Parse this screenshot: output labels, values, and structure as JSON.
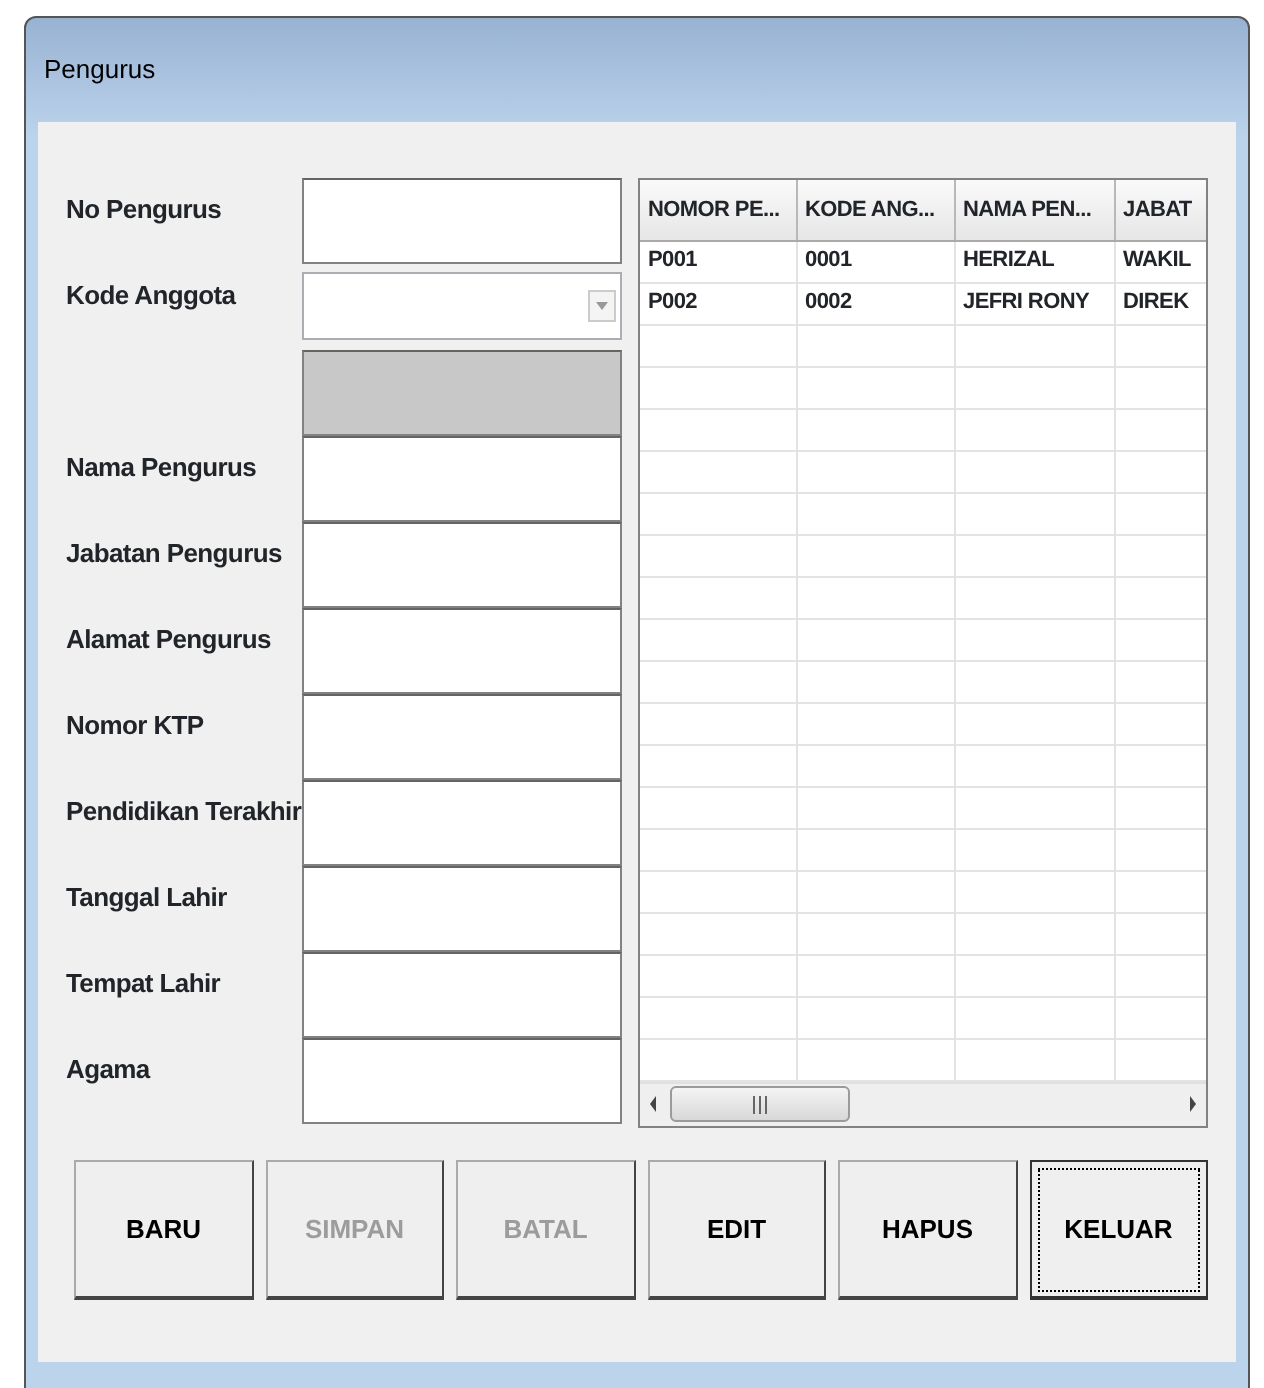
{
  "window": {
    "title": "Pengurus"
  },
  "fields": [
    {
      "label": "No Pengurus",
      "kind": "text",
      "disabled": false
    },
    {
      "label": "Kode Anggota",
      "kind": "combo",
      "disabled": false
    },
    {
      "kind": "text",
      "disabled": true
    },
    {
      "label": "Nama Pengurus",
      "kind": "text",
      "disabled": false
    },
    {
      "label": "Jabatan Pengurus",
      "kind": "text",
      "disabled": false
    },
    {
      "label": "Alamat Pengurus",
      "kind": "text",
      "disabled": false
    },
    {
      "label": "Nomor KTP",
      "kind": "text",
      "disabled": false
    },
    {
      "label": "Pendidikan Terakhir",
      "kind": "text",
      "disabled": false
    },
    {
      "label": "Tanggal Lahir",
      "kind": "text",
      "disabled": false
    },
    {
      "label": "Tempat Lahir",
      "kind": "text",
      "disabled": false
    },
    {
      "label": "Agama",
      "kind": "text",
      "disabled": false
    }
  ],
  "table": {
    "columns": [
      "NOMOR PE...",
      "KODE ANG...",
      "NAMA PEN...",
      "JABAT"
    ],
    "rows": [
      [
        "P001",
        "0001",
        "HERIZAL",
        "WAKIL"
      ],
      [
        "P002",
        "0002",
        "JEFRI RONY",
        "DIREK"
      ]
    ]
  },
  "buttons": [
    {
      "label": "BARU",
      "disabled": false,
      "focused": false
    },
    {
      "label": "SIMPAN",
      "disabled": true,
      "focused": false
    },
    {
      "label": "BATAL",
      "disabled": true,
      "focused": false
    },
    {
      "label": "EDIT",
      "disabled": false,
      "focused": false
    },
    {
      "label": "HAPUS",
      "disabled": false,
      "focused": false
    },
    {
      "label": "KELUAR",
      "disabled": false,
      "focused": true
    }
  ]
}
